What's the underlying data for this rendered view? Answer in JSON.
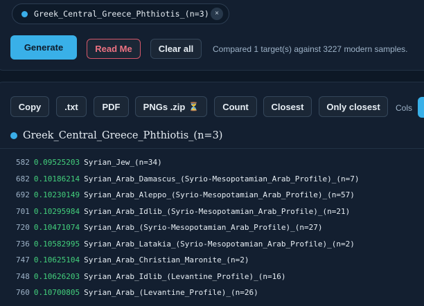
{
  "target_chip": {
    "label": "Greek_Central_Greece_Phthiotis_(n=3)",
    "close": "×"
  },
  "actions": {
    "generate": "Generate",
    "read_me": "Read Me",
    "clear_all": "Clear all",
    "status": "Compared 1 target(s) against 3227 modern samples."
  },
  "toolbar": {
    "copy": "Copy",
    "txt": ".txt",
    "pdf": "PDF",
    "pngs_zip": "PNGs .zip",
    "hourglass": "⏳",
    "count": "Count",
    "closest": "Closest",
    "only_closest": "Only closest",
    "cols": "Cols"
  },
  "results": {
    "sample_title": "Greek_Central_Greece_Phthiotis_(n=3)",
    "rows": [
      {
        "rank": "582",
        "distance": "0.09525203",
        "population": "Syrian_Jew_(n=34)"
      },
      {
        "rank": "682",
        "distance": "0.10186214",
        "population": "Syrian_Arab_Damascus_(Syrio-Mesopotamian_Arab_Profile)_(n=7)"
      },
      {
        "rank": "692",
        "distance": "0.10230149",
        "population": "Syrian_Arab_Aleppo_(Syrio-Mesopotamian_Arab_Profile)_(n=57)"
      },
      {
        "rank": "701",
        "distance": "0.10295984",
        "population": "Syrian_Arab_Idlib_(Syrio-Mesopotamian_Arab_Profile)_(n=21)"
      },
      {
        "rank": "720",
        "distance": "0.10471074",
        "population": "Syrian_Arab_(Syrio-Mesopotamian_Arab_Profile)_(n=27)"
      },
      {
        "rank": "736",
        "distance": "0.10582995",
        "population": "Syrian_Arab_Latakia_(Syrio-Mesopotamian_Arab_Profile)_(n=2)"
      },
      {
        "rank": "747",
        "distance": "0.10625104",
        "population": "Syrian_Arab_Christian_Maronite_(n=2)"
      },
      {
        "rank": "748",
        "distance": "0.10626203",
        "population": "Syrian_Arab_Idlib_(Levantine_Profile)_(n=16)"
      },
      {
        "rank": "760",
        "distance": "0.10700805",
        "population": "Syrian_Arab_(Levantine_Profile)_(n=26)"
      }
    ]
  },
  "colors": {
    "accent": "#39b0e8",
    "distance": "#43d07c",
    "readme_border": "#d6586a",
    "background": "#0d1826",
    "panel": "#131f30"
  }
}
